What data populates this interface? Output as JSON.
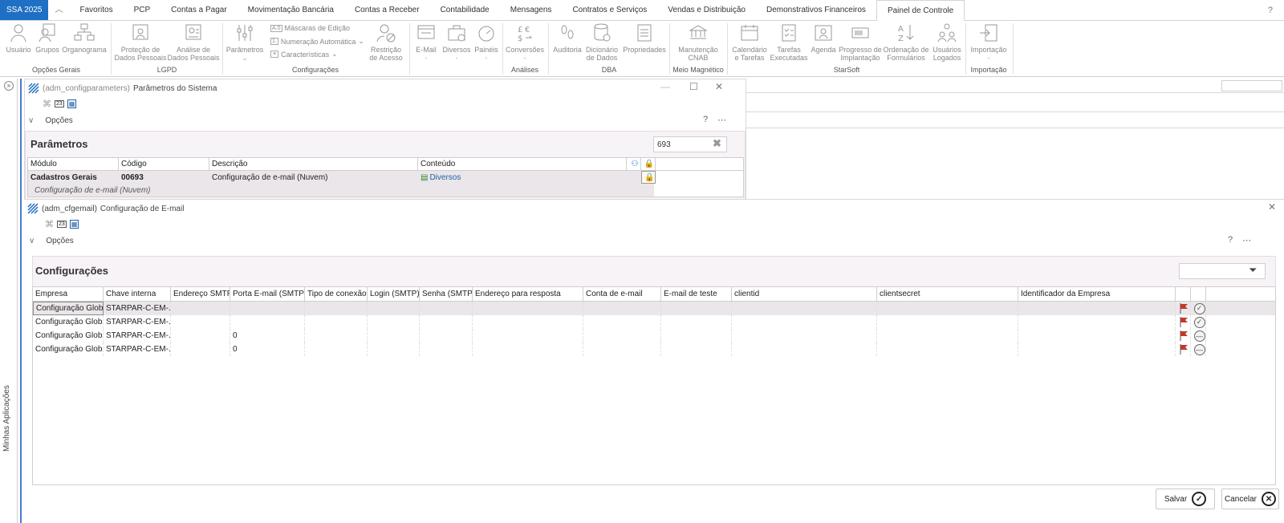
{
  "menu": {
    "app_tab": "SSA 2025",
    "tabs": [
      "Favoritos",
      "PCP",
      "Contas a Pagar",
      "Movimentação Bancária",
      "Contas a Receber",
      "Contabilidade",
      "Mensagens",
      "Contratos e Serviços",
      "Vendas e Distribuição",
      "Demonstrativos Financeiros",
      "Painel de Controle"
    ],
    "active_tab": "Painel de Controle",
    "help": "?"
  },
  "ribbon": {
    "opcoes_gerais": {
      "label": "Opções Gerais",
      "items": [
        "Usuário",
        "Grupos",
        "Organograma"
      ]
    },
    "lgpd": {
      "label": "LGPD",
      "items": [
        [
          "Proteção de",
          "Dados Pessoais"
        ],
        [
          "Análise de",
          "Dados Pessoais"
        ]
      ]
    },
    "configuracoes": {
      "label": "Configurações",
      "parametros": "Parâmetros",
      "small": [
        "Máscaras de Edição",
        "Numeração Automática",
        "Características"
      ],
      "restricao": [
        "Restrição",
        "de Acesso"
      ]
    },
    "misc": [
      "E-Mail",
      "Diversos",
      "Painéis",
      "Conversões"
    ],
    "analises": {
      "label": "Análises"
    },
    "dba": {
      "label": "DBA",
      "items": [
        "Auditoria",
        [
          "Dicionário",
          "de Dados"
        ],
        "Propriedades"
      ]
    },
    "meio": {
      "label": "Meio Magnético",
      "items": [
        [
          "Manutenção",
          "CNAB"
        ]
      ]
    },
    "starsoft": {
      "label": "StarSoft",
      "items": [
        [
          "Calendário",
          "e Tarefas"
        ],
        [
          "Tarefas",
          "Executadas"
        ],
        "Agenda",
        [
          "Progresso de",
          "Implantação"
        ],
        [
          "Ordenação de",
          "Formulários"
        ],
        [
          "Usuários",
          "Logados"
        ]
      ]
    },
    "importacao": {
      "label": "Importação",
      "items": [
        "Importação"
      ]
    }
  },
  "sidebar": {
    "label": "Minhas Aplicações"
  },
  "window1": {
    "code": "(adm_configparameters)",
    "title": "Parâmetros do Sistema",
    "options": "Opções",
    "panel_title": "Parâmetros",
    "search_value": "693",
    "columns": [
      "Módulo",
      "Código",
      "Descrição",
      "Conteúdo"
    ],
    "row": {
      "modulo": "Cadastros Gerais",
      "codigo": "00693",
      "descricao": "Configuração de e-mail (Nuvem)",
      "conteudo": "Diversos"
    },
    "row_detail": "Configuração de e-mail (Nuvem)"
  },
  "window2": {
    "code": "(adm_cfgemail)",
    "title": "Configuração de E-mail",
    "options": "Opções",
    "panel_title": "Configurações",
    "columns": [
      "Empresa",
      "Chave interna",
      "Endereço SMTP",
      "Porta E-mail (SMTP)",
      "Tipo de conexão",
      "Login (SMTP)",
      "Senha (SMTP)",
      "Endereço para resposta",
      "Conta de e-mail",
      "E-mail de teste",
      "clientid",
      "clientsecret",
      "Identificador da Empresa"
    ],
    "rows": [
      {
        "empresa": "Configuração Global",
        "chave": "STARPAR-C-EM-...",
        "porta": ""
      },
      {
        "empresa": "Configuração Global",
        "chave": "STARPAR-C-EM-...",
        "porta": ""
      },
      {
        "empresa": "Configuração Global",
        "chave": "STARPAR-C-EM-...",
        "porta": "0"
      },
      {
        "empresa": "Configuração Global",
        "chave": "STARPAR-C-EM-...",
        "porta": "0"
      }
    ],
    "save": "Salvar",
    "cancel": "Cancelar"
  },
  "colors": {
    "accent": "#1f6fc5",
    "flag": "#c0392b",
    "selected_row": "#ebe6ea",
    "panel": "#f7f3f6"
  }
}
